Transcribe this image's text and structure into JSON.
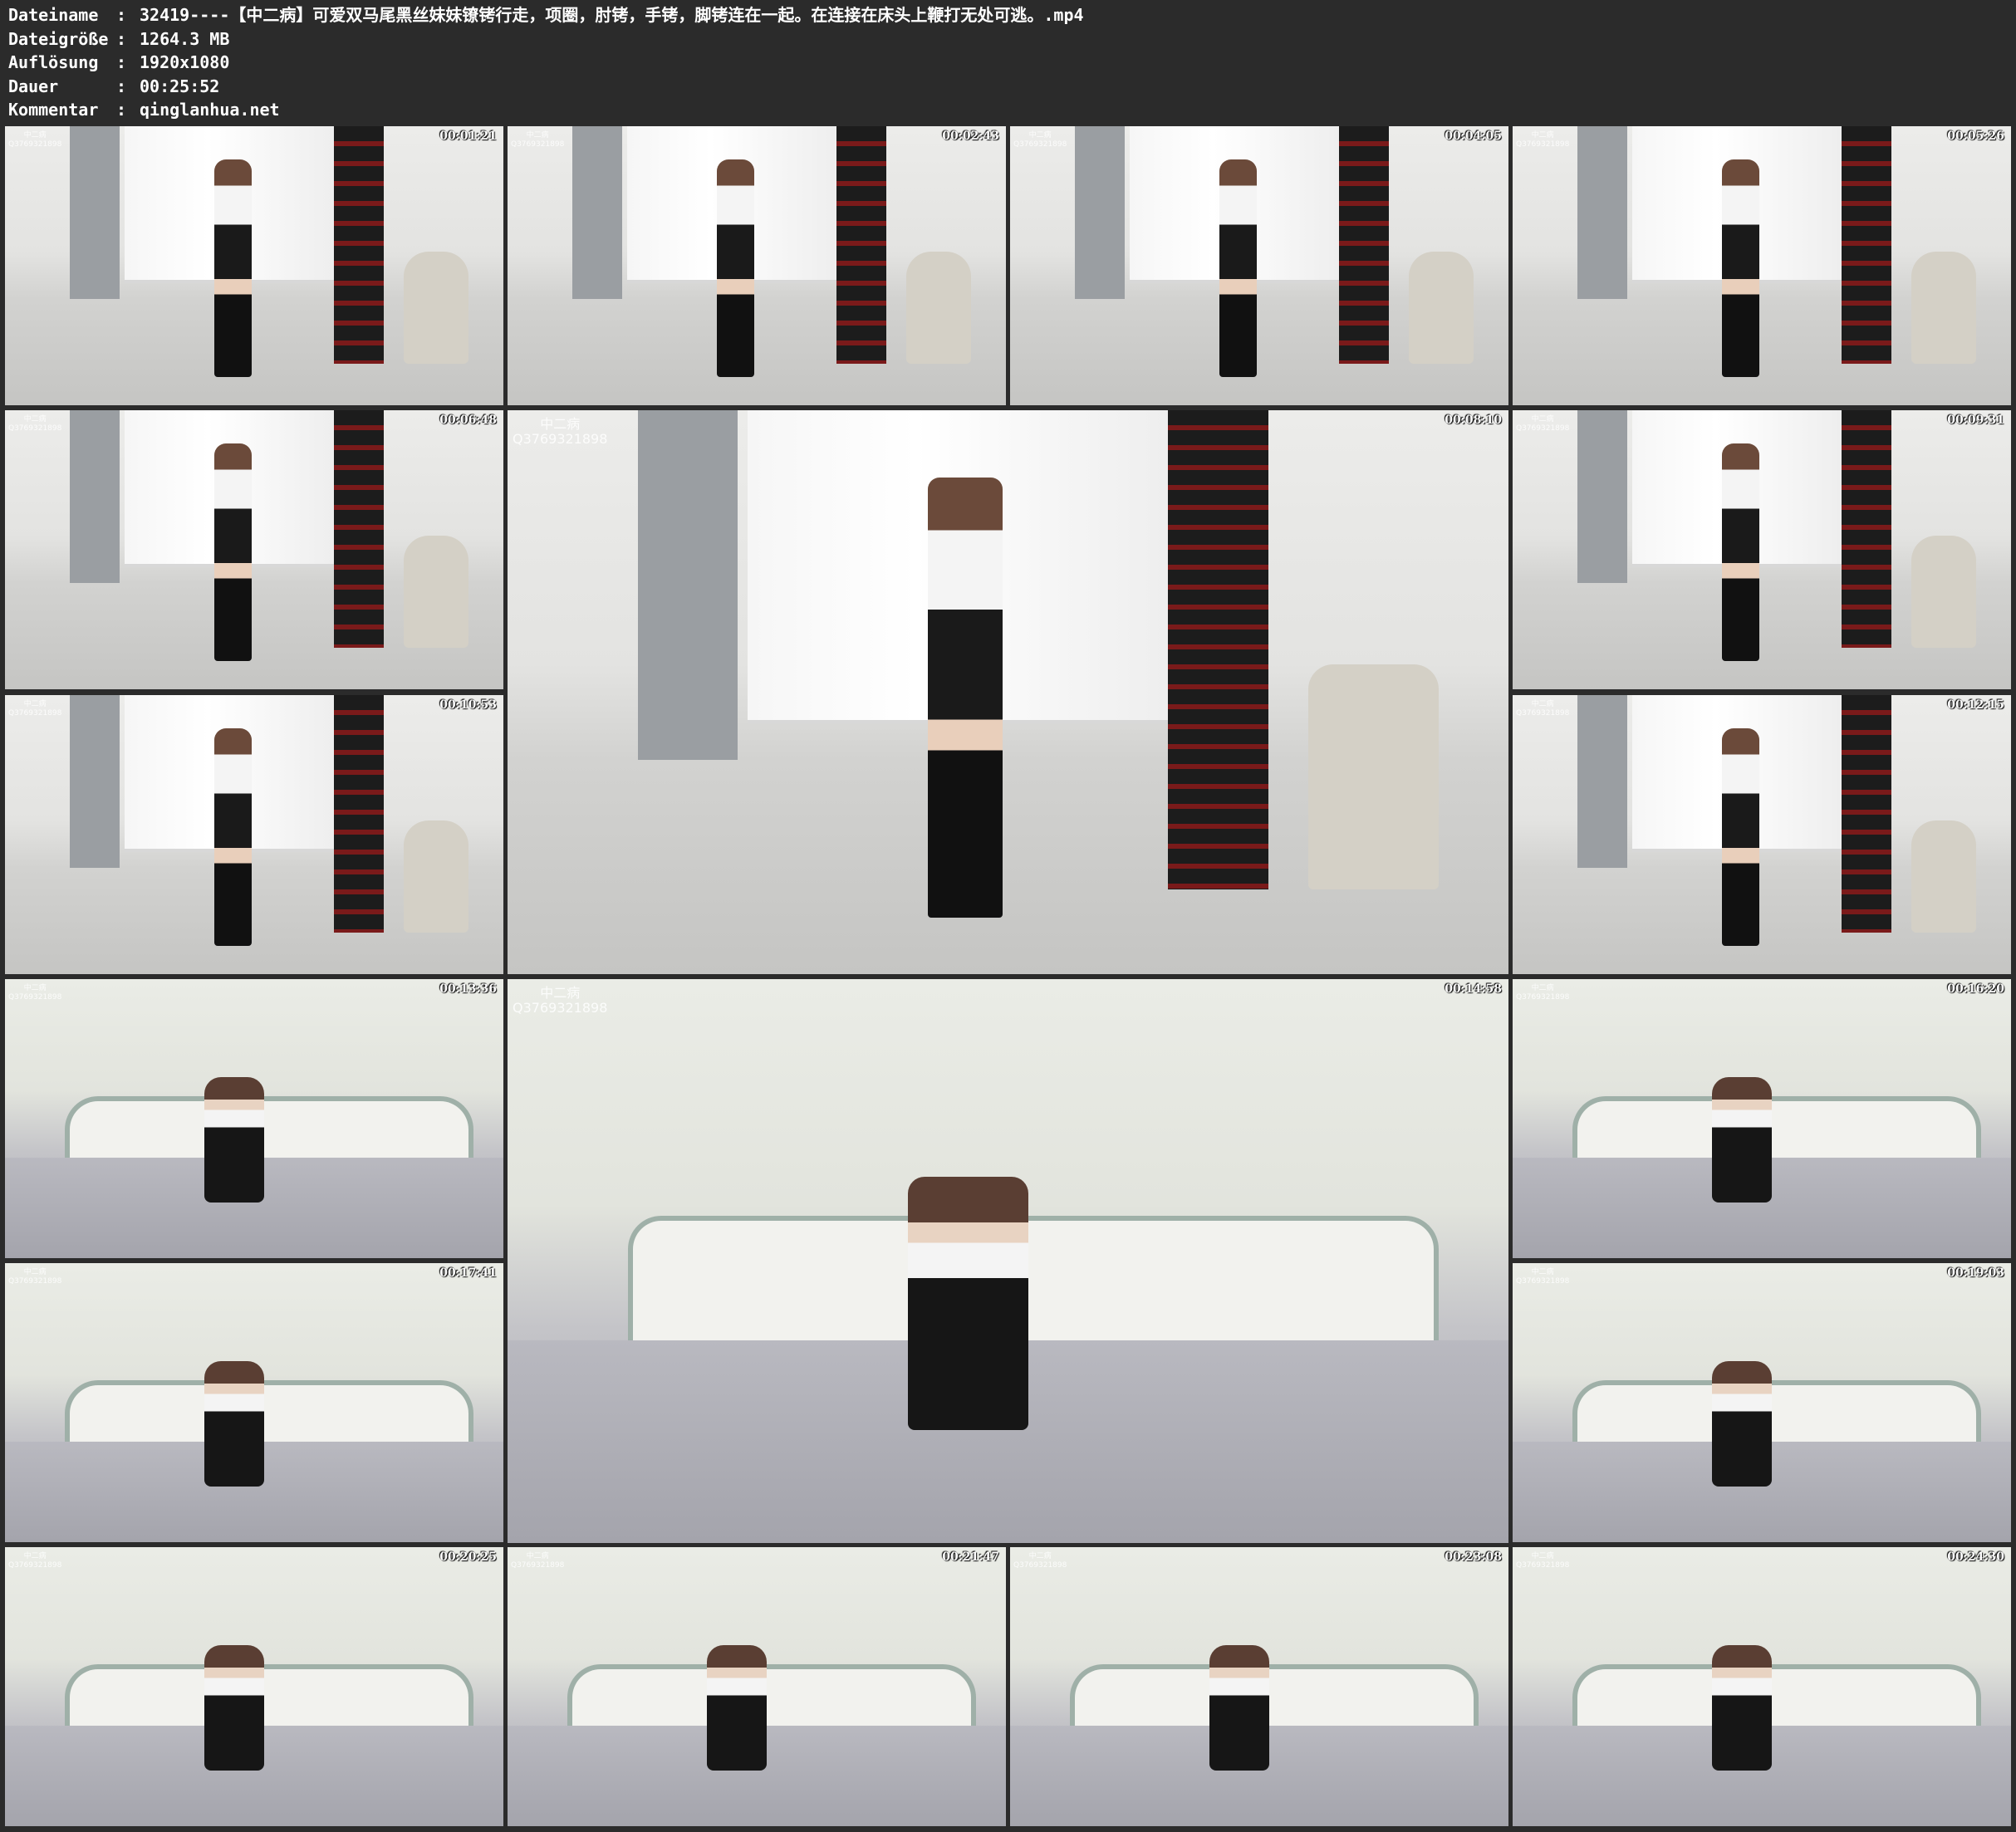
{
  "info": {
    "rows": [
      {
        "key": "Dateiname",
        "sep": ":",
        "value": "32419----【中二病】可爱双马尾黑丝妹妹镣铐行走，项圈，肘铐，手铐，脚铐连在一起。在连接在床头上鞭打无处可逃。.mp4"
      },
      {
        "key": "Dateigröße",
        "sep": ":",
        "value": "1264.3 MB"
      },
      {
        "key": "Auflösung",
        "sep": ":",
        "value": "1920x1080"
      },
      {
        "key": "Dauer",
        "sep": ":",
        "value": "00:25:52"
      },
      {
        "key": "Kommentar",
        "sep": ":",
        "value": "qinglanhua.net"
      }
    ]
  },
  "watermark": {
    "line1": "中二病",
    "line2": "Q3769321898"
  },
  "thumbnails": [
    {
      "time": "00:01:21",
      "scene": "room-standing"
    },
    {
      "time": "00:02:43",
      "scene": "room-two-people"
    },
    {
      "time": "00:04:05",
      "scene": "room-standing"
    },
    {
      "time": "00:05:26",
      "scene": "room-two-people"
    },
    {
      "time": "00:06:48",
      "scene": "room-kneeling"
    },
    {
      "time": "00:08:10",
      "scene": "room-side-large"
    },
    {
      "time": "00:09:31",
      "scene": "room-back"
    },
    {
      "time": "00:10:53",
      "scene": "room-side"
    },
    {
      "time": "00:12:15",
      "scene": "room-standing"
    },
    {
      "time": "00:13:36",
      "scene": "bed-two-people"
    },
    {
      "time": "00:14:58",
      "scene": "bed-sitting-large"
    },
    {
      "time": "00:16:20",
      "scene": "bed-lying"
    },
    {
      "time": "00:17:41",
      "scene": "bed-sitting"
    },
    {
      "time": "00:19:03",
      "scene": "bed-closeup"
    },
    {
      "time": "00:20:25",
      "scene": "bed-face"
    },
    {
      "time": "00:21:47",
      "scene": "bed-two-people"
    },
    {
      "time": "00:23:08",
      "scene": "bed-sitting"
    },
    {
      "time": "00:24:30",
      "scene": "bed-standing"
    }
  ]
}
